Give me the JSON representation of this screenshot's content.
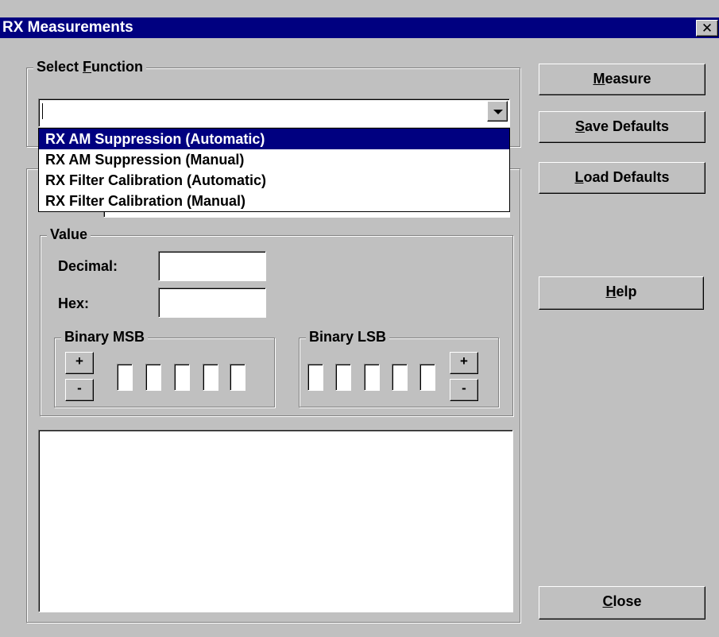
{
  "window": {
    "title": "RX Measurements",
    "close_glyph": "✕"
  },
  "select_function": {
    "legend_pre": "Select ",
    "legend_mnemonic": "F",
    "legend_post": "unction",
    "combo_value": "",
    "options": [
      "RX AM Suppression (Automatic)",
      "RX AM Suppression (Manual)",
      "RX Filter Calibration (Automatic)",
      "RX Filter Calibration (Manual)"
    ],
    "selected_index": 0
  },
  "value_group": {
    "legend": "Value",
    "decimal_label": "Decimal:",
    "decimal_value": "",
    "hex_label": "Hex:",
    "hex_value": ""
  },
  "binary_msb": {
    "legend": "Binary MSB",
    "plus": "+",
    "minus": "-"
  },
  "binary_lsb": {
    "legend": "Binary LSB",
    "plus": "+",
    "minus": "-"
  },
  "buttons": {
    "measure": {
      "mnemonic": "M",
      "rest": "easure"
    },
    "save_defaults": {
      "mnemonic": "S",
      "rest": "ave Defaults"
    },
    "load_defaults": {
      "mnemonic": "L",
      "rest": "oad Defaults"
    },
    "help": {
      "mnemonic": "H",
      "rest": "elp"
    },
    "close": {
      "mnemonic": "C",
      "rest": "lose"
    }
  },
  "output_text": "",
  "colors": {
    "face": "#c0c0c0",
    "titlebar": "#000080",
    "highlight": "#000080"
  }
}
